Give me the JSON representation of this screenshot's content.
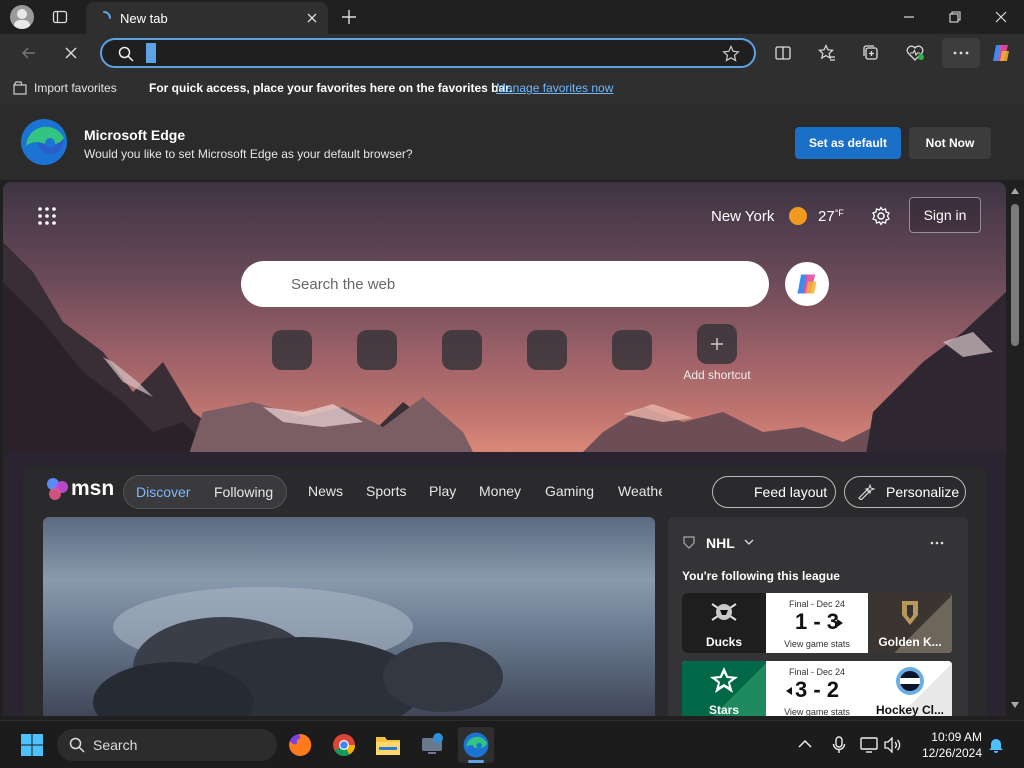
{
  "browser": {
    "tab_title": "New tab",
    "address_value": "",
    "favorites_bar": {
      "import_label": "Import favorites",
      "hint": "For quick access, place your favorites here on the favorites bar.",
      "manage_link": "Manage favorites now"
    },
    "banner": {
      "title": "Microsoft Edge",
      "message": "Would you like to set Microsoft Edge as your default browser?",
      "primary_button": "Set as default",
      "secondary_button": "Not Now"
    }
  },
  "newtab": {
    "weather": {
      "city": "New York",
      "temp": "27",
      "unit": "°F"
    },
    "sign_in": "Sign in",
    "search_placeholder": "Search the web",
    "add_shortcut_label": "Add shortcut"
  },
  "feed": {
    "logo": "msn",
    "tabs": {
      "discover": "Discover",
      "following": "Following"
    },
    "nav": [
      "News",
      "Sports",
      "Play",
      "Money",
      "Gaming",
      "Weathe"
    ],
    "feed_layout": "Feed layout",
    "personalize": "Personalize",
    "nhl": {
      "league": "NHL",
      "following_text": "You're following this league",
      "games": [
        {
          "status": "Final - Dec 24",
          "score": "1 - 3",
          "stats": "View game stats",
          "home": "Ducks",
          "away": "Golden K..."
        },
        {
          "status": "Final - Dec 24",
          "score": "3 - 2",
          "stats": "View game stats",
          "home": "Stars",
          "away": "Hockey Cl..."
        }
      ]
    }
  },
  "taskbar": {
    "search_label": "Search",
    "time": "10:09 AM",
    "date": "12/26/2024"
  },
  "colors": {
    "accent": "#5ea2e6",
    "primary_button": "#1a6fc6",
    "link": "#6fb8ff",
    "discover_active": "#7fb8ff"
  }
}
